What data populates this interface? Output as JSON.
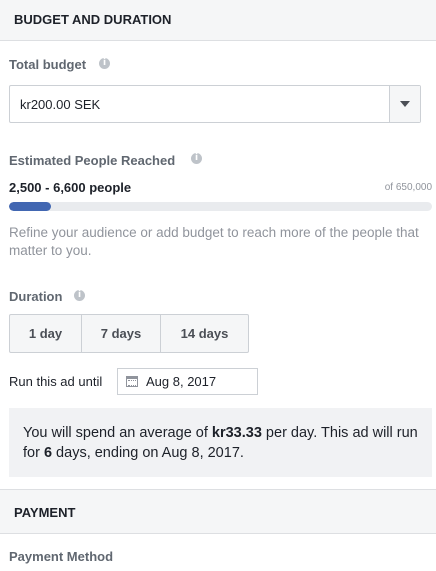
{
  "budget_section": {
    "title": "BUDGET AND DURATION",
    "total_budget": {
      "label": "Total budget",
      "value": "kr200.00 SEK",
      "info_icon": "info-icon"
    },
    "reach": {
      "label": "Estimated People Reached",
      "range": "2,500 - 6,600 people",
      "total": "of 650,000",
      "progress_fraction": 0.1,
      "bar_color": "#4267b2",
      "hint": "Refine your audience or add budget to reach more of the people that matter to you."
    },
    "duration": {
      "label": "Duration",
      "options": [
        "1 day",
        "7 days",
        "14 days"
      ],
      "run_until_label": "Run this ad until",
      "end_date": "Aug 8, 2017",
      "calendar_icon": "calendar-icon"
    },
    "summary": {
      "p1": "You will spend an average of ",
      "amount": "kr33.33",
      "p2": " per day. This ad will run for ",
      "days": "6",
      "p3": " days, ending on Aug 8, 2017."
    }
  },
  "payment_section": {
    "title": "PAYMENT",
    "method_label": "Payment Method"
  }
}
